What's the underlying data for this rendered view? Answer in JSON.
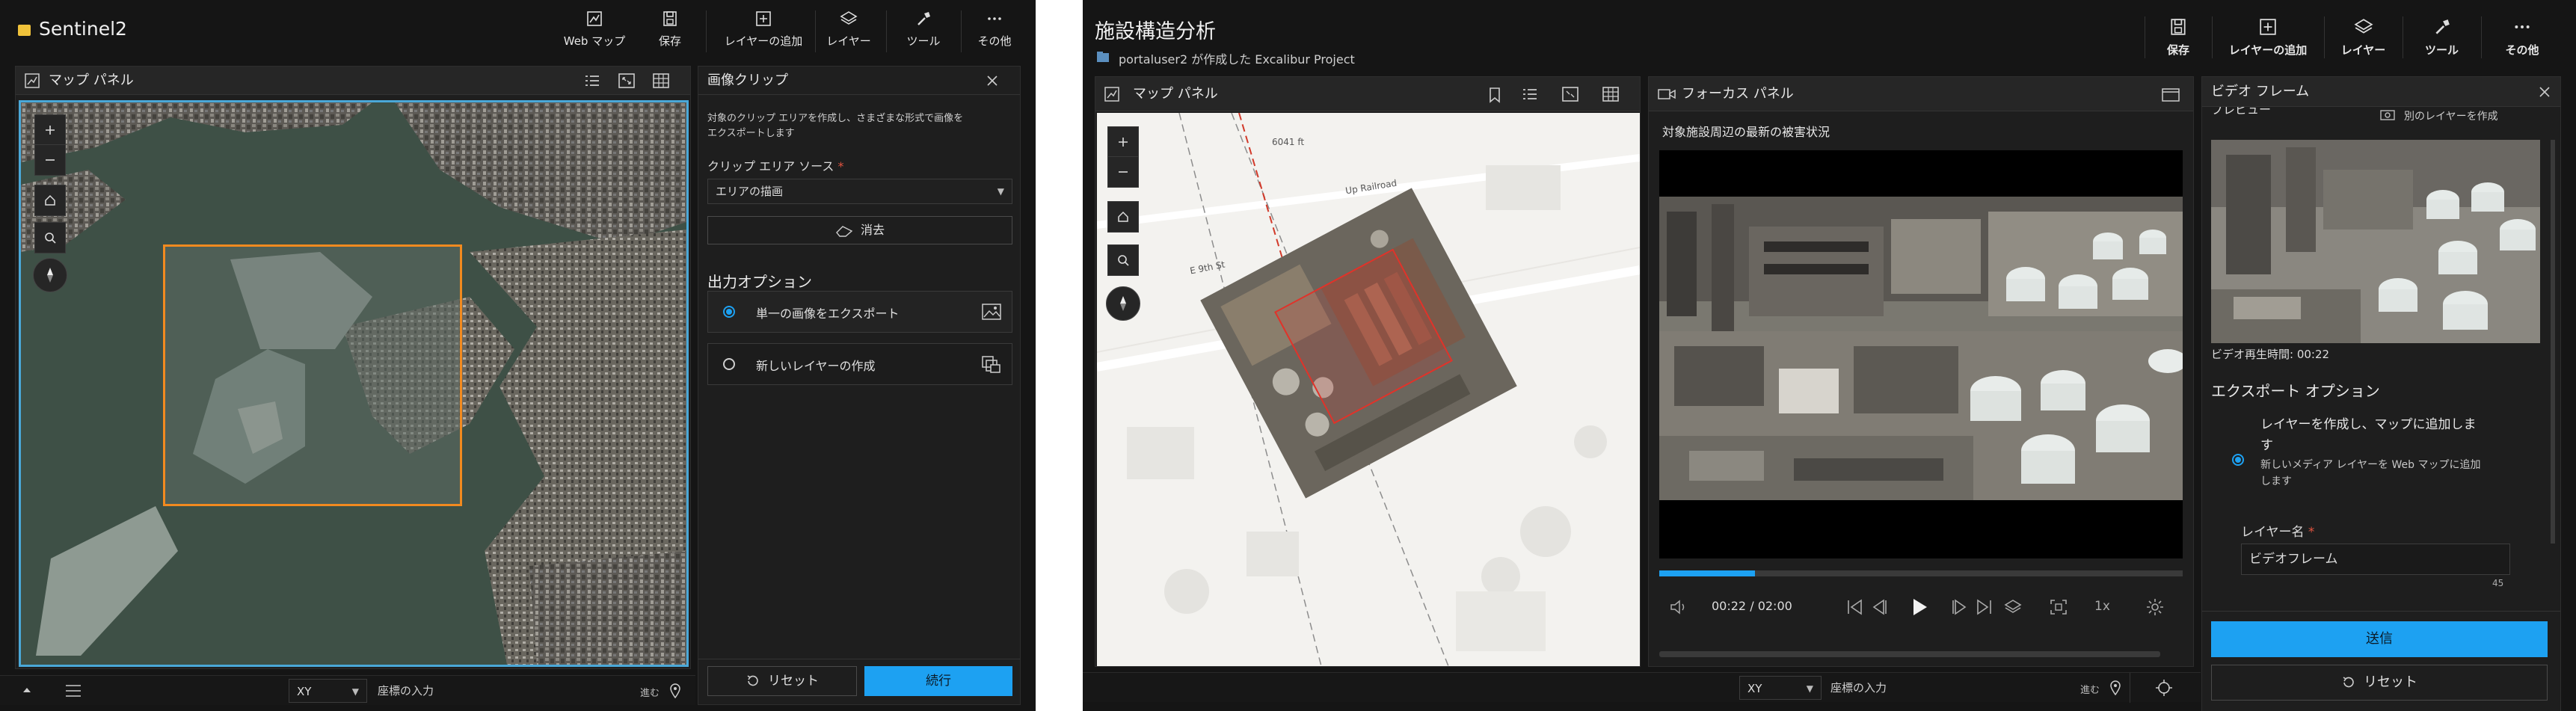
{
  "left": {
    "app_title": "Sentinel2",
    "toolbar": [
      {
        "icon": "webmap-icon",
        "label": "Web マップ"
      },
      {
        "icon": "save-icon",
        "label": "保存"
      },
      {
        "icon": "add-layer-icon",
        "label": "レイヤーの追加"
      },
      {
        "icon": "layers-icon",
        "label": "レイヤー"
      },
      {
        "icon": "tools-icon",
        "label": "ツール"
      },
      {
        "icon": "more-icon",
        "label": "その他"
      }
    ],
    "map_panel": {
      "title": "マップ パネル"
    },
    "clip": {
      "title": "画像クリップ",
      "description_line1": "対象のクリップ エリアを作成し、さまざまな形式で画像を",
      "description_line2": "エクスポートします",
      "source_label": "クリップ エリア ソース",
      "required_mark": "*",
      "source_value": "エリアの描画",
      "clear_label": "消去",
      "output_title": "出力オプション",
      "options": [
        "単一の画像をエクスポート",
        "新しいレイヤーの作成"
      ],
      "reset_label": "リセット",
      "continue_label": "続行"
    },
    "footer": {
      "coord_system": "XY",
      "coord_placeholder": "座標の入力",
      "go_label": "進む"
    }
  },
  "right": {
    "app_title": "施設構造分析",
    "subtitle": "portaluser2 が作成した Excalibur Project",
    "toolbar": [
      {
        "icon": "save-icon",
        "label": "保存"
      },
      {
        "icon": "add-layer-icon",
        "label": "レイヤーの追加"
      },
      {
        "icon": "layers-icon",
        "label": "レイヤー"
      },
      {
        "icon": "tools-icon",
        "label": "ツール"
      },
      {
        "icon": "more-icon",
        "label": "その他"
      }
    ],
    "map_panel": {
      "title": "マップ パネル",
      "label_6041": "6041 ft",
      "road_up": "Up Railroad",
      "road_e9": "E 9th St"
    },
    "focus_panel": {
      "title": "フォーカス パネル",
      "caption": "対象施設周辺の最新の被害状況",
      "current_time": "00:22",
      "separator": "/",
      "duration": "02:00",
      "progress": 0.183,
      "speed": "1x"
    },
    "video_frame": {
      "title": "ビデオ フレーム",
      "preview_label": "プレビュー",
      "other_layer_label": "別のレイヤーを作成",
      "playback_time_label": "ビデオ再生時間: 00:22",
      "export_title": "エクスポート オプション",
      "option_line1": "レイヤーを作成し、マップに追加しま",
      "option_line2": "す",
      "option_desc1": "新しいメディア レイヤーを Web マップに追加",
      "option_desc2": "します",
      "layer_name_label": "レイヤー名",
      "required_mark": "*",
      "layer_name_value": "ビデオフレーム",
      "char_count": "45",
      "send_label": "送信",
      "reset_label": "リセット"
    },
    "footer": {
      "coord_system": "XY",
      "coord_placeholder": "座標の入力",
      "go_label": "進む"
    }
  },
  "colors": {
    "accent": "#1da1f2",
    "clip_rect": "#f28a1f",
    "selection": "#4aa8d8",
    "footprint": "#e0332a"
  }
}
